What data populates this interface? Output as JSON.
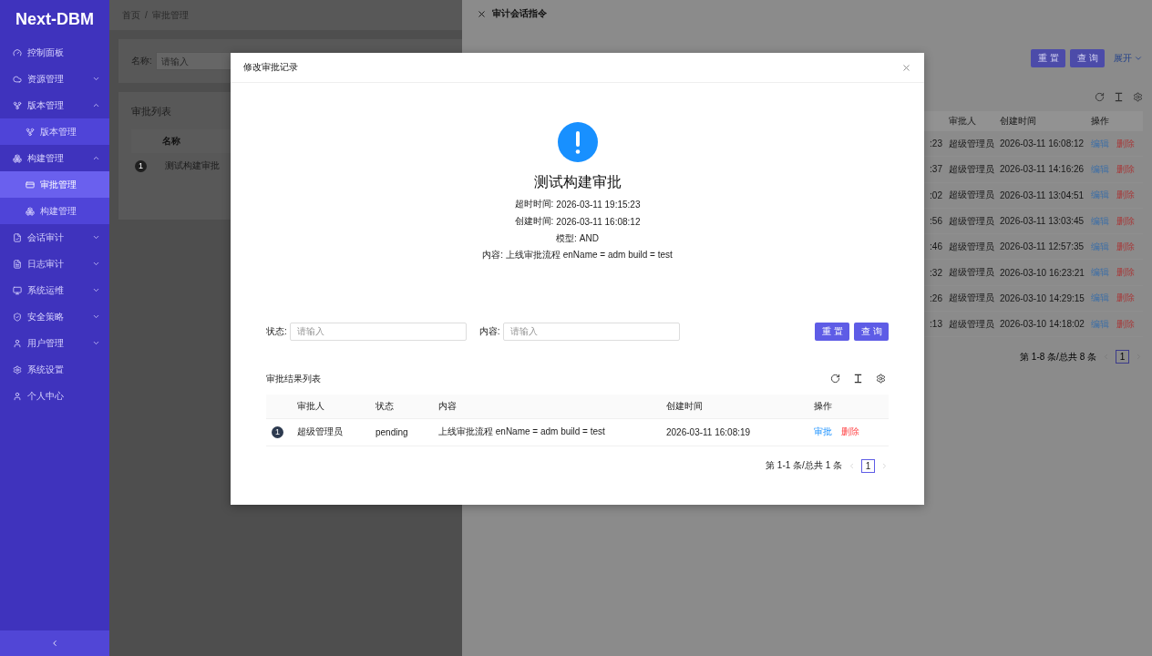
{
  "sidebar": {
    "logo": "Next-DBM",
    "items": [
      {
        "kind": "link",
        "label": "控制面板",
        "selected": false
      },
      {
        "kind": "group",
        "label": "资源管理",
        "expanded": false,
        "selected": false
      },
      {
        "kind": "group",
        "label": "版本管理",
        "expanded": true,
        "selected": false,
        "children": [
          {
            "label": "版本管理",
            "selected": false
          }
        ]
      },
      {
        "kind": "group",
        "label": "构建管理",
        "expanded": true,
        "selected": false,
        "children": [
          {
            "label": "审批管理",
            "selected": true
          },
          {
            "label": "构建管理",
            "selected": false
          }
        ]
      },
      {
        "kind": "group",
        "label": "会话审计",
        "expanded": false,
        "selected": false
      },
      {
        "kind": "group",
        "label": "日志审计",
        "expanded": false,
        "selected": false
      },
      {
        "kind": "group",
        "label": "系统运维",
        "expanded": false,
        "selected": false
      },
      {
        "kind": "group",
        "label": "安全策略",
        "expanded": false,
        "selected": false
      },
      {
        "kind": "group",
        "label": "用户管理",
        "expanded": false,
        "selected": false
      },
      {
        "kind": "link",
        "label": "系统设置",
        "selected": false
      },
      {
        "kind": "link",
        "label": "个人中心",
        "selected": false
      }
    ]
  },
  "page": {
    "breadcrumb": [
      "首页",
      "审批管理"
    ],
    "breadcrumb_separator": "/",
    "search": {
      "label": "名称:",
      "placeholder": "请输入"
    },
    "table": {
      "title": "审批列表",
      "columns": [
        "名称"
      ],
      "rows": [
        {
          "index": "1",
          "name": "测试构建审批"
        }
      ]
    }
  },
  "drawer": {
    "title": "审计会话指令",
    "buttons": [
      "重置",
      "查询"
    ],
    "expand": "展开",
    "table": {
      "columns": [
        "审批人",
        "创建时间",
        "操作"
      ],
      "rows": [
        {
          "column_1": ":23",
          "approver": "超级管理员",
          "created": "2026-03-11 16:08:12",
          "actions": [
            "编辑",
            "删除"
          ]
        },
        {
          "column_1": ":37",
          "approver": "超级管理员",
          "created": "2026-03-11 14:16:26",
          "actions": [
            "编辑",
            "删除"
          ]
        },
        {
          "column_1": ":02",
          "approver": "超级管理员",
          "created": "2026-03-11 13:04:51",
          "actions": [
            "编辑",
            "删除"
          ]
        },
        {
          "column_1": ":56",
          "approver": "超级管理员",
          "created": "2026-03-11 13:03:45",
          "actions": [
            "编辑",
            "删除"
          ]
        },
        {
          "column_1": ":46",
          "approver": "超级管理员",
          "created": "2026-03-11 12:57:35",
          "actions": [
            "编辑",
            "删除"
          ]
        },
        {
          "column_1": ":32",
          "approver": "超级管理员",
          "created": "2026-03-10 16:23:21",
          "actions": [
            "编辑",
            "删除"
          ]
        },
        {
          "column_1": ":26",
          "approver": "超级管理员",
          "created": "2026-03-10 14:29:15",
          "actions": [
            "编辑",
            "删除"
          ]
        },
        {
          "column_1": ":13",
          "approver": "超级管理员",
          "created": "2026-03-10 14:18:02",
          "actions": [
            "编辑",
            "删除"
          ]
        }
      ],
      "pagination": {
        "summary": "第 1-8 条/总共 8 条",
        "page": "1"
      }
    }
  },
  "modal": {
    "title": "修改审批记录",
    "heading": "测试构建审批",
    "details": [
      {
        "label": "超时时间:",
        "value": "2026-03-11 19:15:23"
      },
      {
        "label": "创建时间:",
        "value": "2026-03-11 16:08:12"
      },
      {
        "label": "模型:",
        "value": "AND"
      },
      {
        "label": "内容:",
        "value": "上线审批流程 enName = adm build = test"
      }
    ],
    "filters": [
      {
        "label": "状态:",
        "placeholder": "请输入"
      },
      {
        "label": "内容:",
        "placeholder": "请输入"
      }
    ],
    "buttons": [
      "重置",
      "查询"
    ],
    "results": {
      "title": "审批结果列表",
      "columns": [
        "审批人",
        "状态",
        "内容",
        "创建时间",
        "操作"
      ],
      "rows": [
        {
          "index": "1",
          "approver": "超级管理员",
          "status": "pending",
          "content": "上线审批流程 enName = adm build = test",
          "created": "2026-03-11 16:08:19",
          "actions": [
            "审批",
            "删除"
          ]
        }
      ],
      "pagination": {
        "summary": "第 1-1 条/总共 1 条",
        "page": "1"
      }
    }
  }
}
